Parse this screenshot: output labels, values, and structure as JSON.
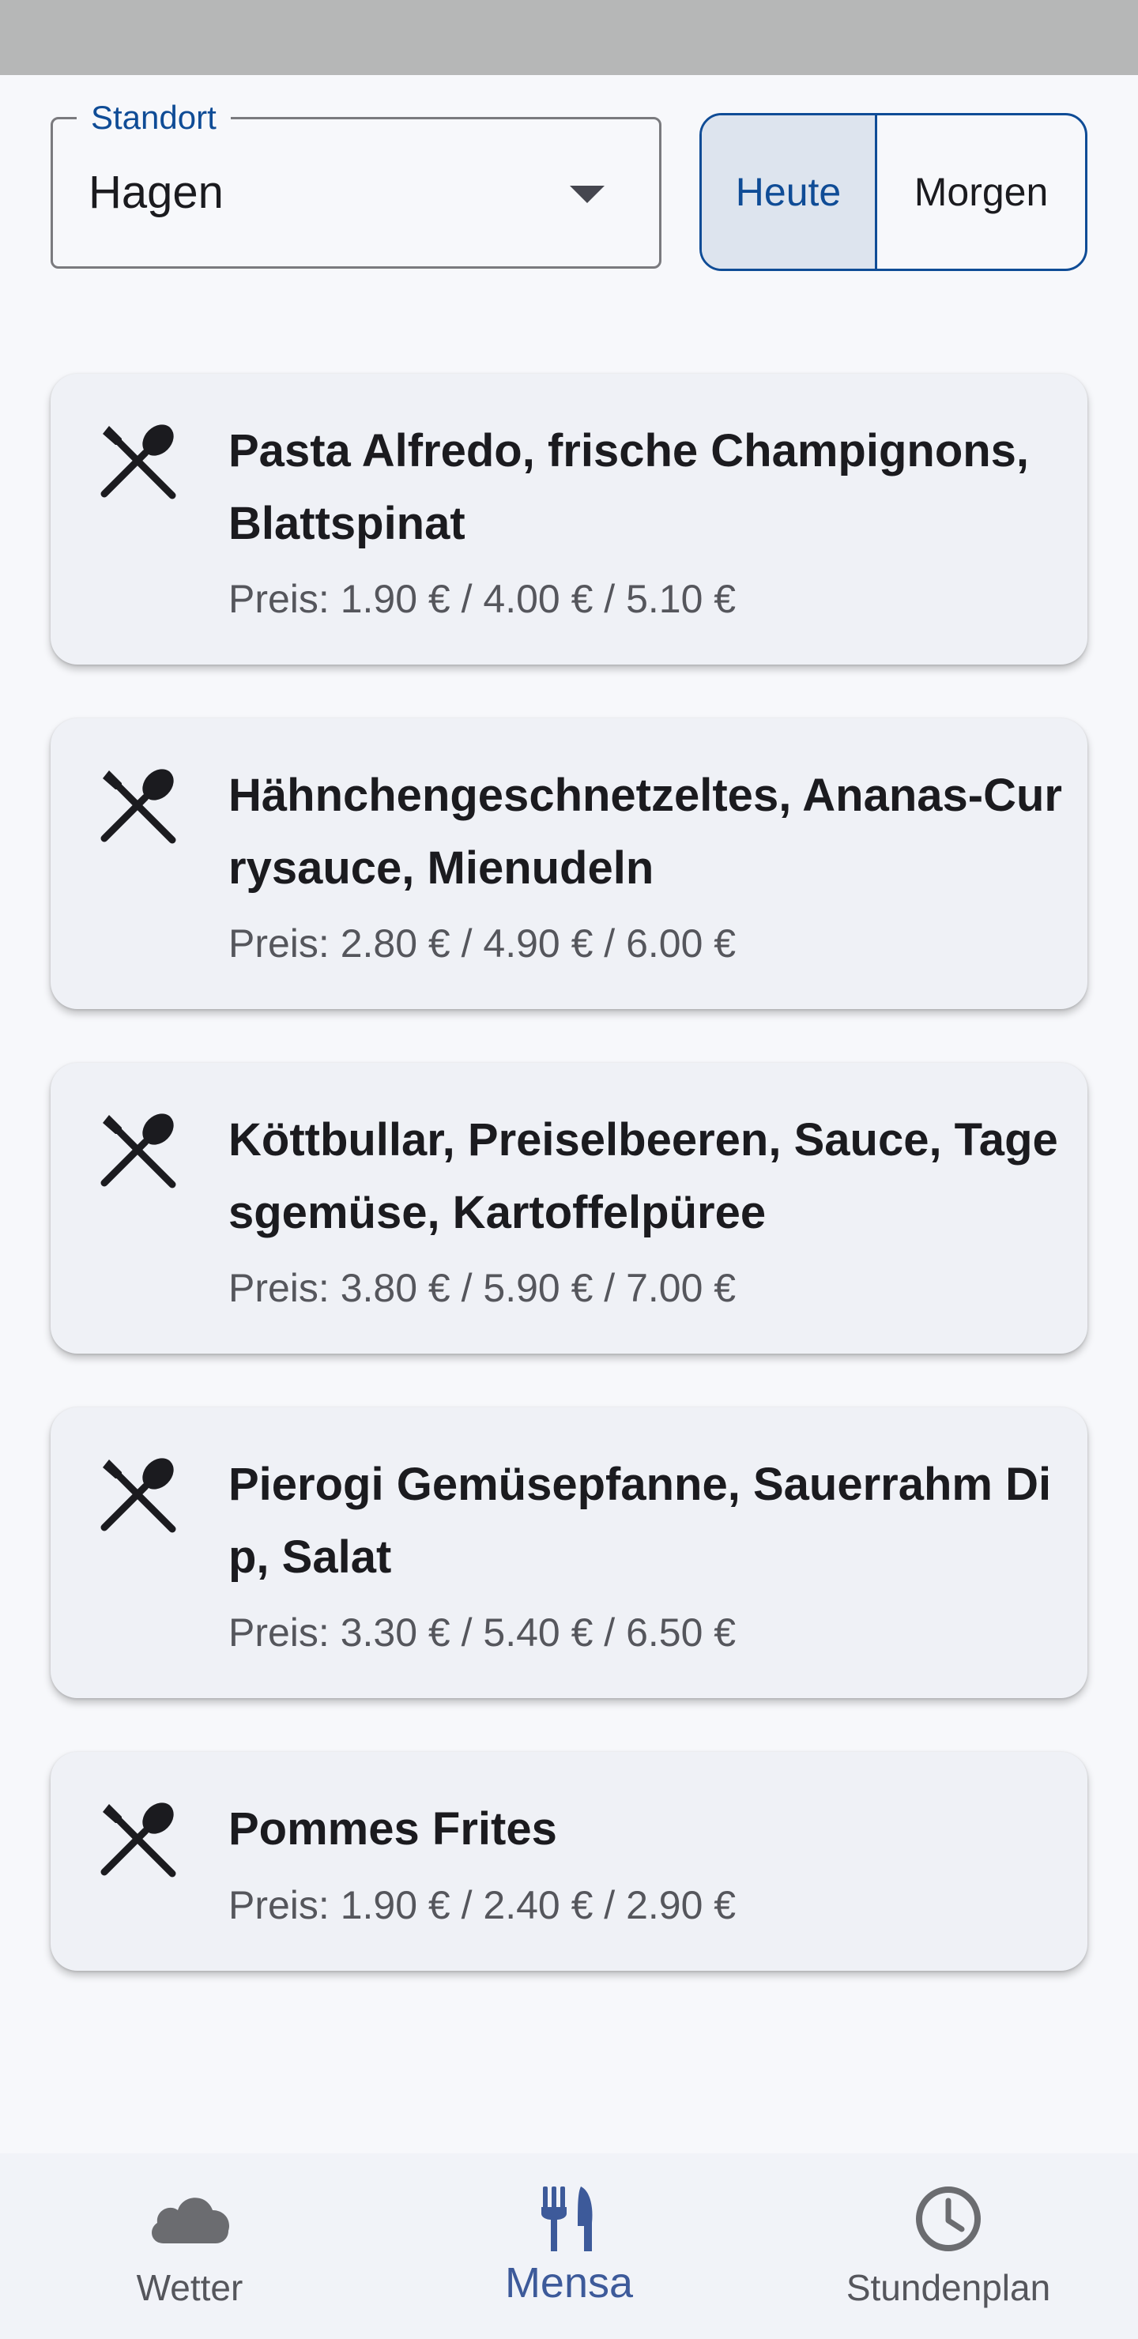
{
  "location": {
    "legend": "Standort",
    "value": "Hagen"
  },
  "day_toggle": {
    "today": "Heute",
    "tomorrow": "Morgen",
    "selected": "Heute"
  },
  "meals": [
    {
      "title": "Pasta Alfredo, frische Champignons, Blattspinat",
      "price": "Preis: 1.90 € / 4.00 € / 5.10 €",
      "icon": "cutlery-icon"
    },
    {
      "title": "Hähnchengeschnetzeltes, Ananas-Currysauce, Mienudeln",
      "price": "Preis: 2.80 € / 4.90 € / 6.00 €",
      "icon": "cutlery-icon"
    },
    {
      "title": "Köttbullar, Preiselbeeren, Sauce, Tagesgemüse, Kartoffelpüree",
      "price": "Preis: 3.80 € / 5.90 € / 7.00 €",
      "icon": "cutlery-icon"
    },
    {
      "title": "Pierogi Gemüsepfanne, Sauerrahm Dip, Salat",
      "price": "Preis: 3.30 € / 5.40 € / 6.50 €",
      "icon": "cutlery-icon"
    },
    {
      "title": "Pommes Frites",
      "price": "Preis: 1.90 € / 2.40 € / 2.90 €",
      "icon": "cutlery-icon"
    }
  ],
  "nav": {
    "weather": {
      "label": "Wetter",
      "icon": "cloud-icon"
    },
    "mensa": {
      "label": "Mensa",
      "icon": "fork-knife-icon",
      "active": true
    },
    "schedule": {
      "label": "Stundenplan",
      "icon": "clock-icon"
    }
  },
  "colors": {
    "accent": "#0f4c96",
    "nav_active": "#3d5a9a",
    "card_bg": "#eff1f6",
    "page_bg": "#f7f8fb",
    "status_bar": "#b6b7b7"
  }
}
